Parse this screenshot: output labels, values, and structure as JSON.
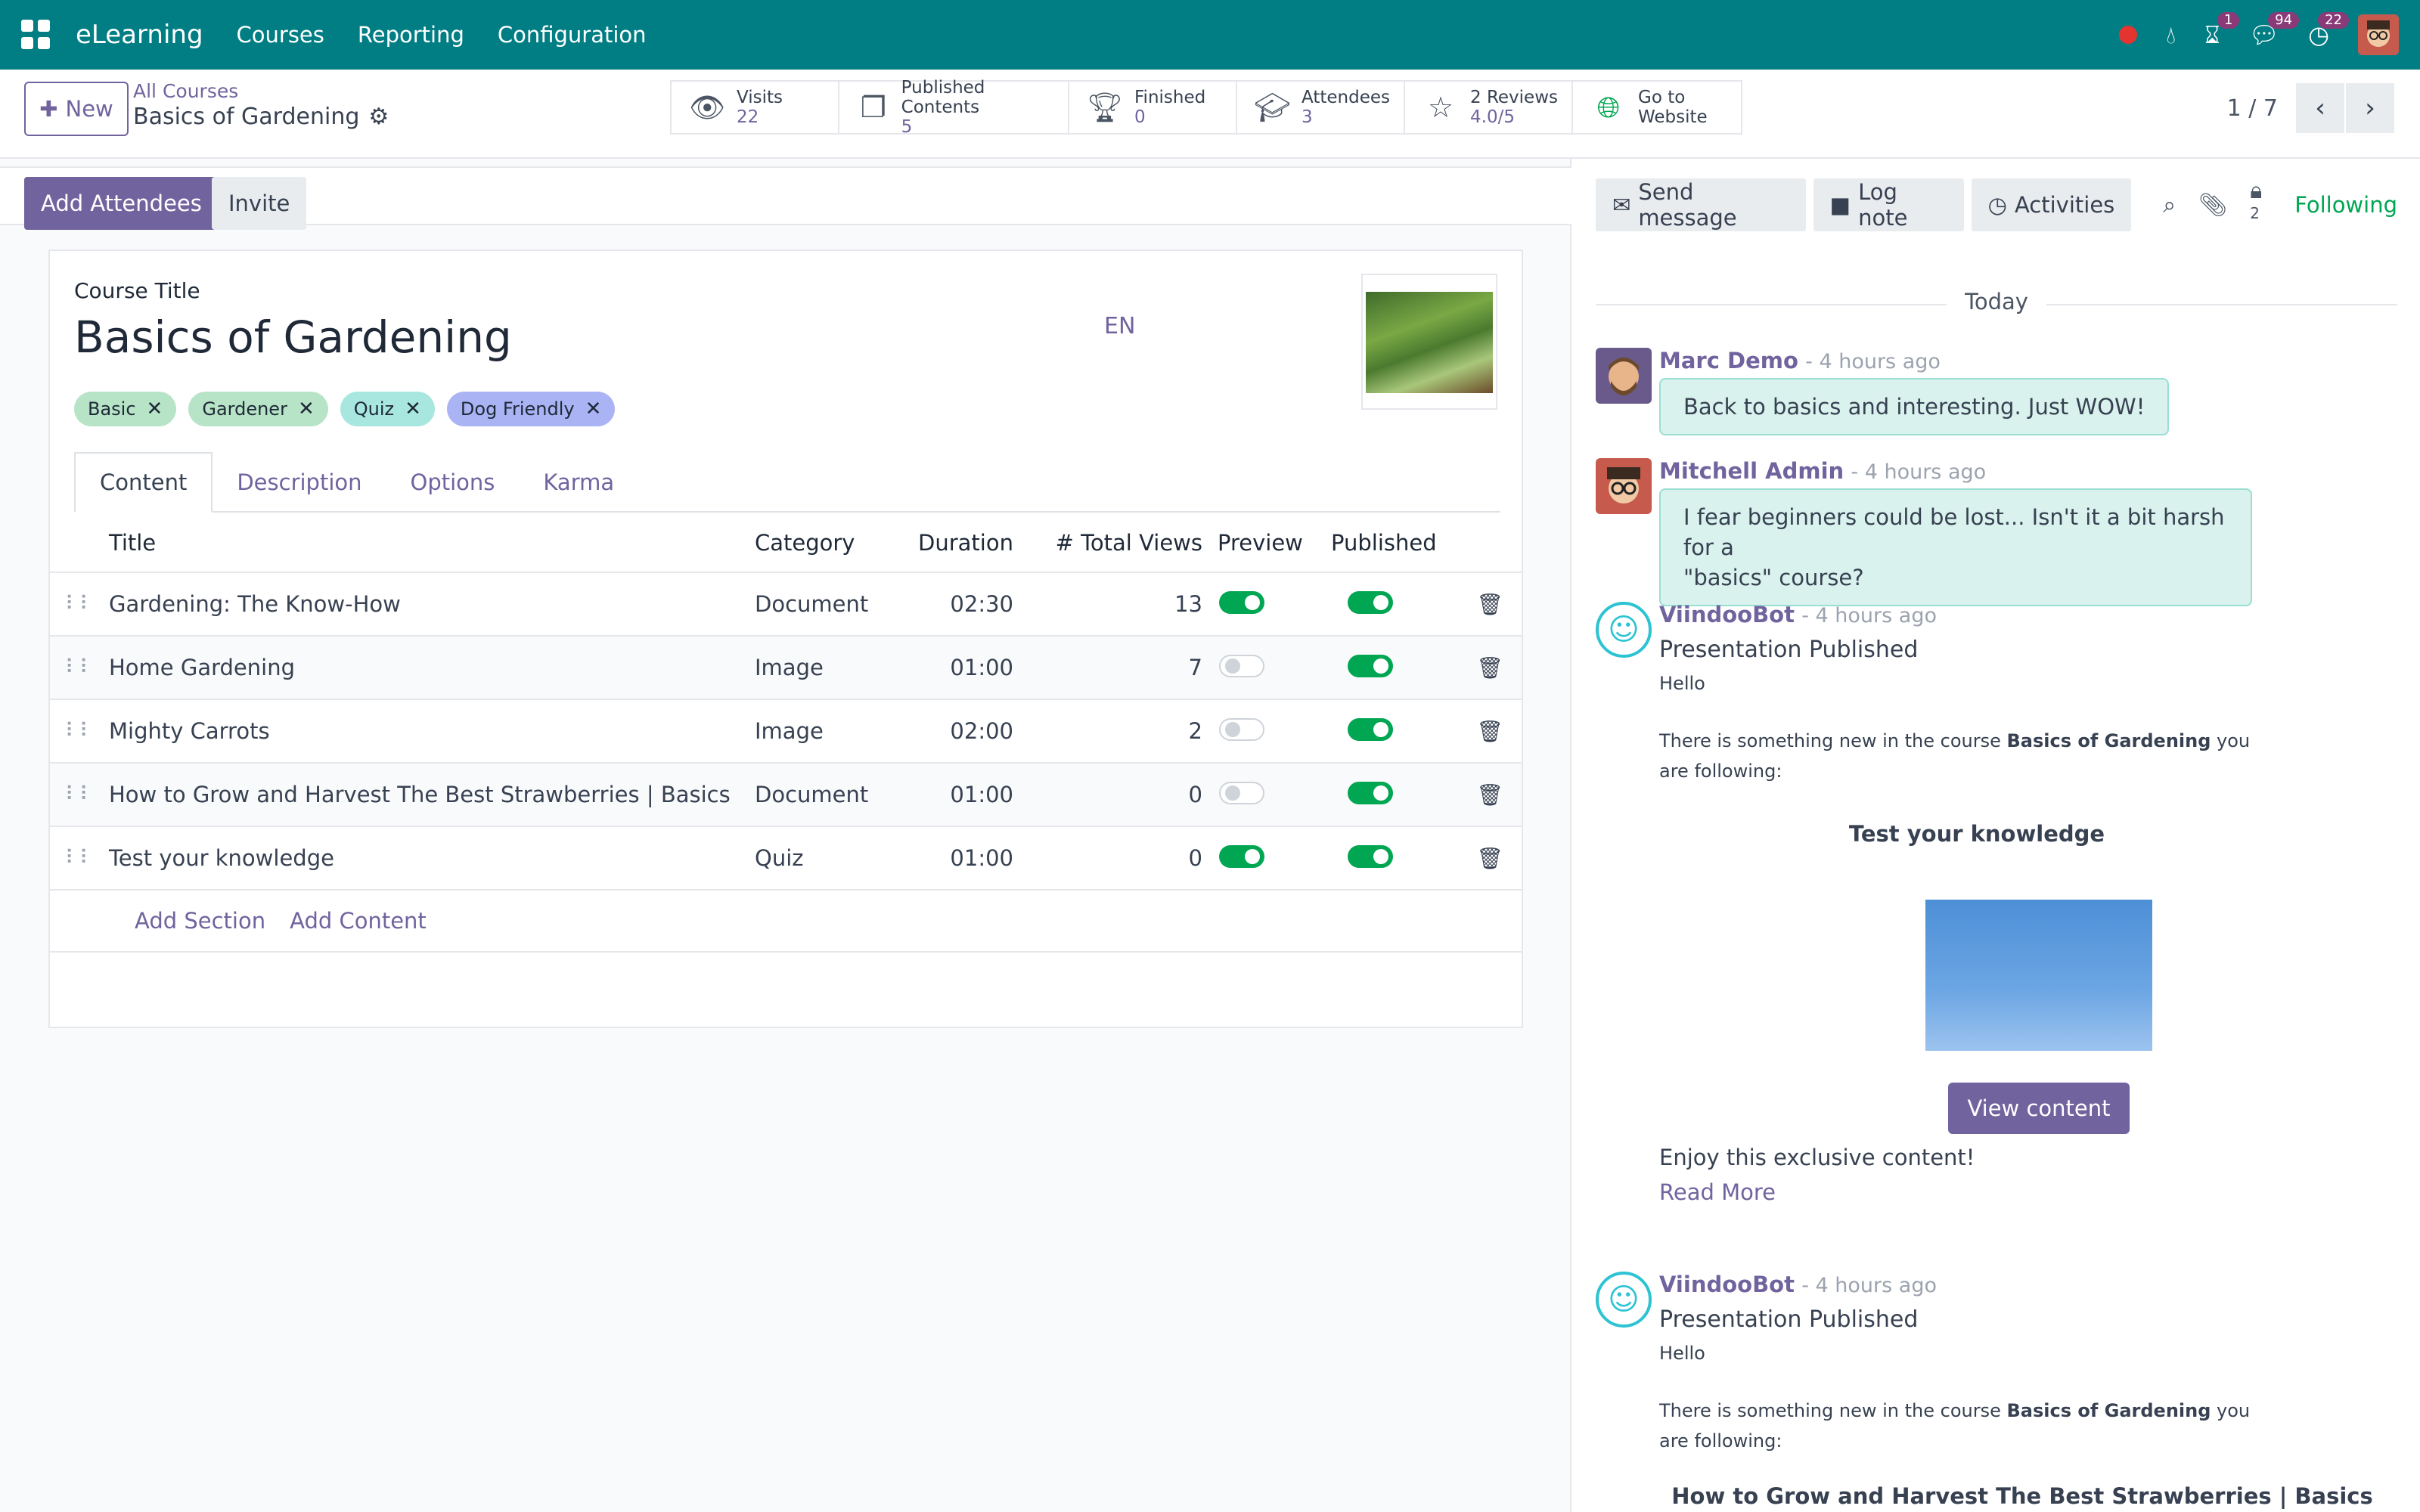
{
  "navbar": {
    "brand": "eLearning",
    "menus": [
      "Courses",
      "Reporting",
      "Configuration"
    ],
    "badges": {
      "activities": "1",
      "messages": "94",
      "clock": "22"
    }
  },
  "control": {
    "new_label": "New",
    "breadcrumb_parent": "All Courses",
    "breadcrumb_current": "Basics of Gardening",
    "smart_buttons": [
      {
        "icon": "eye-icon",
        "label": "Visits",
        "value": "22"
      },
      {
        "icon": "files-icon",
        "label": "Published Contents",
        "value": "5"
      },
      {
        "icon": "trophy-icon",
        "label": "Finished",
        "value": "0"
      },
      {
        "icon": "graduation-cap-icon",
        "label": "Attendees",
        "value": "3"
      },
      {
        "icon": "star-icon",
        "label": "2 Reviews",
        "value": "4.0/5"
      },
      {
        "icon": "globe-icon",
        "label": "Go to",
        "value": "Website"
      }
    ],
    "pager": "1 / 7"
  },
  "statusbar": {
    "add_attendees": "Add Attendees",
    "invite": "Invite"
  },
  "form": {
    "course_title_label": "Course Title",
    "course_title": "Basics of Gardening",
    "lang": "EN",
    "tags": [
      {
        "label": "Basic",
        "color": "#b7e4c7"
      },
      {
        "label": "Gardener",
        "color": "#b7e4c7"
      },
      {
        "label": "Quiz",
        "color": "#a8e6e0"
      },
      {
        "label": "Dog Friendly",
        "color": "#aab4f5"
      }
    ],
    "tabs": [
      "Content",
      "Description",
      "Options",
      "Karma"
    ],
    "columns": {
      "title": "Title",
      "category": "Category",
      "duration": "Duration",
      "views": "# Total Views",
      "preview": "Preview",
      "published": "Published"
    },
    "rows": [
      {
        "title": "Gardening: The Know-How",
        "category": "Document",
        "duration": "02:30",
        "views": "13",
        "preview": true,
        "published": true
      },
      {
        "title": "Home Gardening",
        "category": "Image",
        "duration": "01:00",
        "views": "7",
        "preview": false,
        "published": true
      },
      {
        "title": "Mighty Carrots",
        "category": "Image",
        "duration": "02:00",
        "views": "2",
        "preview": false,
        "published": true
      },
      {
        "title": "How to Grow and Harvest The Best Strawberries | Basics",
        "category": "Document",
        "duration": "01:00",
        "views": "0",
        "preview": false,
        "published": true
      },
      {
        "title": "Test your knowledge",
        "category": "Quiz",
        "duration": "01:00",
        "views": "0",
        "preview": true,
        "published": true
      }
    ],
    "add_section": "Add Section",
    "add_content": "Add Content"
  },
  "chatter": {
    "send_message": "Send message",
    "log_note": "Log note",
    "activities": "Activities",
    "followers_count": "2",
    "following": "Following",
    "date_sep": "Today",
    "msg1": {
      "author": "Marc Demo",
      "time": "- 4 hours ago",
      "body": "Back to basics and interesting. Just WOW!"
    },
    "msg2": {
      "author": "Mitchell Admin",
      "time": "- 4 hours ago",
      "body_line1": "I fear beginners could be lost... Isn't it a bit harsh for a",
      "body_line2": "\"basics\" course?"
    },
    "msg3": {
      "author": "ViindooBot",
      "time": "- 4 hours ago",
      "subject": "Presentation Published",
      "hello": "Hello",
      "intro_a": "There is something new in the course ",
      "intro_course": "Basics of Gardening",
      "intro_b": " you are following:",
      "content_title": "Test your knowledge",
      "view_btn": "View content",
      "enjoy": "Enjoy this exclusive content!",
      "read_more": "Read More"
    },
    "msg4": {
      "author": "ViindooBot",
      "time": "- 4 hours ago",
      "subject": "Presentation Published",
      "hello": "Hello",
      "intro_a": "There is something new in the course ",
      "intro_course": "Basics of Gardening",
      "intro_b": " you are following:",
      "content_title": "How to Grow and Harvest The Best Strawberries | Basics"
    }
  }
}
